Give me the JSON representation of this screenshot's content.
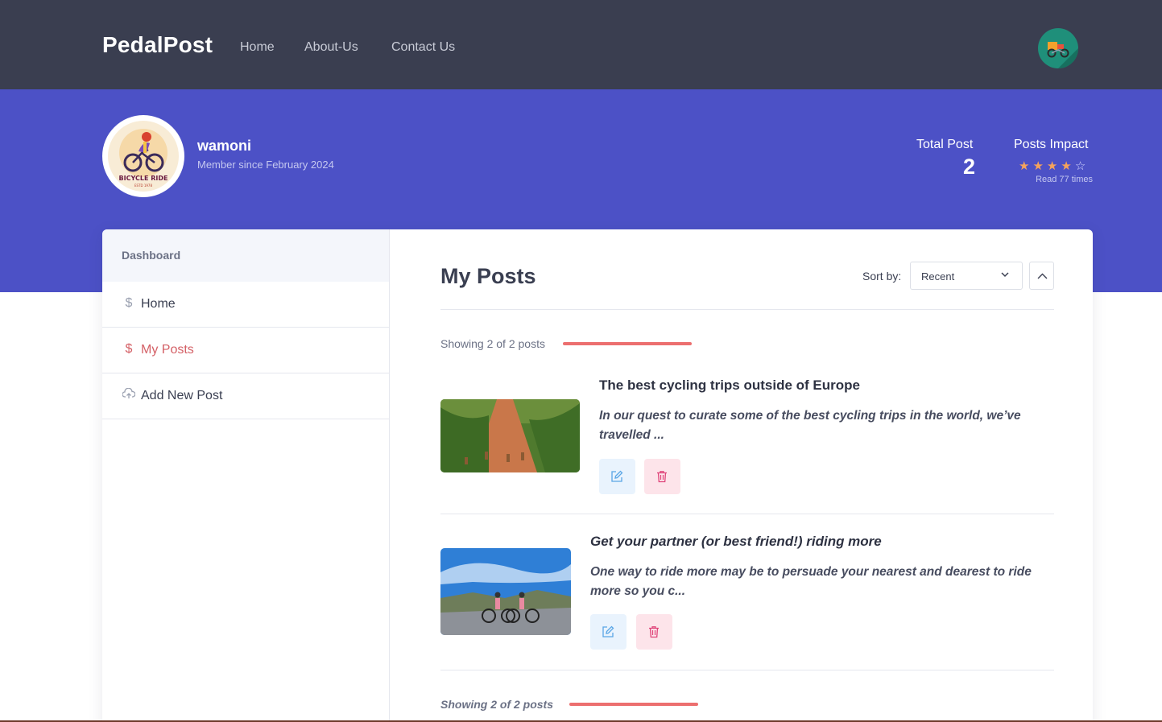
{
  "header": {
    "brand": "PedalPost",
    "nav": [
      "Home",
      "About-Us",
      "Contact Us"
    ],
    "avatar_icon": "cargo-bike-icon"
  },
  "profile": {
    "username": "wamoni",
    "member_since": "Member since February 2024",
    "logo_text": "BICYCLE RIDE",
    "logo_subtext": "ESTD 1978",
    "total_post_label": "Total Post",
    "total_post_value": "2",
    "impact_label": "Posts Impact",
    "rating": 4,
    "rating_max": 5,
    "read_times": "Read 77 times"
  },
  "sidebar": {
    "title": "Dashboard",
    "items": [
      {
        "label": "Home",
        "icon": "dollar-icon"
      },
      {
        "label": "My Posts",
        "icon": "dollar-icon"
      },
      {
        "label": "Add New Post",
        "icon": "cloud-upload-icon"
      }
    ]
  },
  "main": {
    "title": "My Posts",
    "sort_label": "Sort by:",
    "sort_value": "Recent",
    "showing": "Showing 2 of 2 posts",
    "showing_bottom": "Showing 2 of 2 posts",
    "posts": [
      {
        "title": "The best cycling trips outside of Europe",
        "excerpt": "In our quest to curate some of the best cycling trips in the world, we’ve travelled ..."
      },
      {
        "title": "Get your partner (or best friend!) riding more",
        "excerpt": "One way to ride more may be to persuade your nearest and dearest to ride more so you c..."
      }
    ]
  },
  "colors": {
    "header_bg": "#3a3e50",
    "band_bg": "#4c51c6",
    "accent": "#ec6f6f",
    "active": "#d46066"
  }
}
